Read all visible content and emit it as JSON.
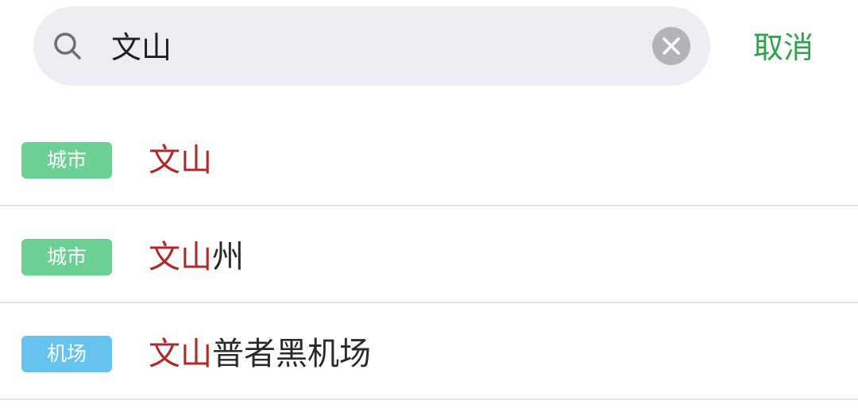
{
  "search": {
    "query": "文山",
    "cancel_label": "取消"
  },
  "results": [
    {
      "tag": "城市",
      "tag_color": "#6ccf93",
      "match": "文山",
      "rest": ""
    },
    {
      "tag": "城市",
      "tag_color": "#6ccf93",
      "match": "文山",
      "rest": "州"
    },
    {
      "tag": "机场",
      "tag_color": "#66c3ef",
      "match": "文山",
      "rest": "普者黑机场"
    }
  ],
  "colors": {
    "accent_green": "#2ea44f",
    "match_red": "#b02a2a",
    "text_dark": "#2a2a2a",
    "search_bg": "#eeeef2"
  },
  "icons": {
    "search": "search-icon",
    "clear": "clear-icon"
  }
}
